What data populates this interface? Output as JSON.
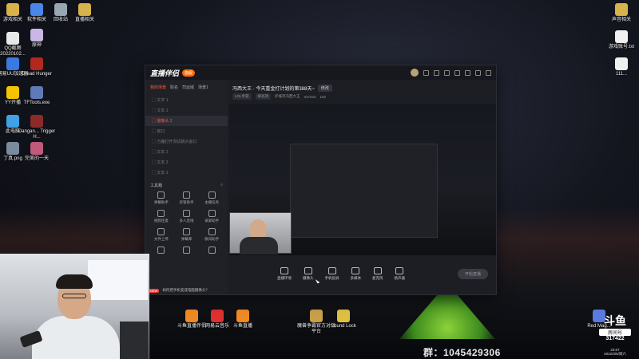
{
  "desktop": {
    "left_icons": [
      {
        "label": "游戏相关",
        "color": "#d8b24a"
      },
      {
        "label": "软件相关",
        "color": "#4a86e8"
      },
      {
        "label": "回收站",
        "color": "#9aa6b2"
      },
      {
        "label": "直播相关",
        "color": "#d8b24a"
      },
      {
        "label": "QQ截图 20220102...",
        "color": "#e8e8e8"
      },
      {
        "label": "原神",
        "color": "#c9b8e6"
      },
      {
        "label": "网易UU加速器",
        "color": "#3a7ae0"
      },
      {
        "label": "Dread Hunger",
        "color": "#b0281e"
      },
      {
        "label": "YY开播",
        "color": "#f5c400"
      },
      {
        "label": "TFTools.exe",
        "color": "#5e7ab8"
      },
      {
        "label": "此电脑",
        "color": "#3fa2e6"
      },
      {
        "label": "Dangan... Trigger H...",
        "color": "#8c2a2a"
      },
      {
        "label": "丁真.png",
        "color": "#7c8aa0"
      },
      {
        "label": "完美的一天",
        "color": "#c05a7a"
      }
    ],
    "right_icons": [
      {
        "label": "声音相关",
        "color": "#d8b24a"
      },
      {
        "label": "游戏账号.txt",
        "color": "#f0f0f0"
      },
      {
        "label": "111...",
        "color": "#f0f0f0"
      }
    ],
    "bottom_icons": [
      {
        "label": "斗鱼直播伴侣",
        "color": "#f08a24"
      },
      {
        "label": "网易云音乐",
        "color": "#e03030"
      },
      {
        "label": "斗鱼直播",
        "color": "#f08a24"
      },
      {
        "label": "魔兽争霸官方对战平台",
        "color": "#c9a04a"
      },
      {
        "label": "Sound Lock",
        "color": "#e0c040"
      },
      {
        "label": "Red Mag...",
        "color": "#5a7ae0"
      }
    ]
  },
  "app": {
    "logo": "直播伴侣",
    "logo_badge": "旗舰",
    "tabs": [
      "我的场景",
      "取名",
      "司运域",
      "场景1"
    ],
    "scenes": [
      {
        "label": "文字 1",
        "selected": false
      },
      {
        "label": "文本 1",
        "selected": false
      },
      {
        "label": "摄像头 2",
        "selected": true
      },
      {
        "label": "窗口",
        "selected": false
      },
      {
        "label": "万魔打开测试镜头窗口",
        "selected": false
      },
      {
        "label": "文本 2",
        "selected": false
      },
      {
        "label": "文本 3",
        "selected": false
      },
      {
        "label": "文本 1",
        "selected": false
      }
    ],
    "tools_title": "工具箱",
    "tools": [
      "弹幕助手",
      "房管助手",
      "主播任务",
      "视频连麦",
      "多人连线",
      "录屏助手",
      "文件上传",
      "弹幕库",
      "歌词助手",
      "",
      "",
      ""
    ],
    "stream_title": "冯西大王 · 今天重金打计划的第388天~",
    "edit_label": "修改",
    "sub": {
      "category": "LOL手游",
      "sub_category": "峡谷顶",
      "room": "护城河冯西大王",
      "room_id": "317422",
      "hot": "102"
    },
    "bottom_tools": [
      "直播环境",
      "摄像头",
      "手机投屏",
      "多媒体",
      "麦克风",
      "扬声器"
    ],
    "start_button": "开始直播",
    "hint_badge": "NEW",
    "hint": "如何把手机变成电脑摄像头？"
  },
  "overlay": {
    "qq_group": "群：1045429306",
    "room_label": "房间号",
    "room_logo": "斗鱼",
    "room_number": "317422",
    "time": "23:07",
    "date": "2022/3/5/周六"
  }
}
